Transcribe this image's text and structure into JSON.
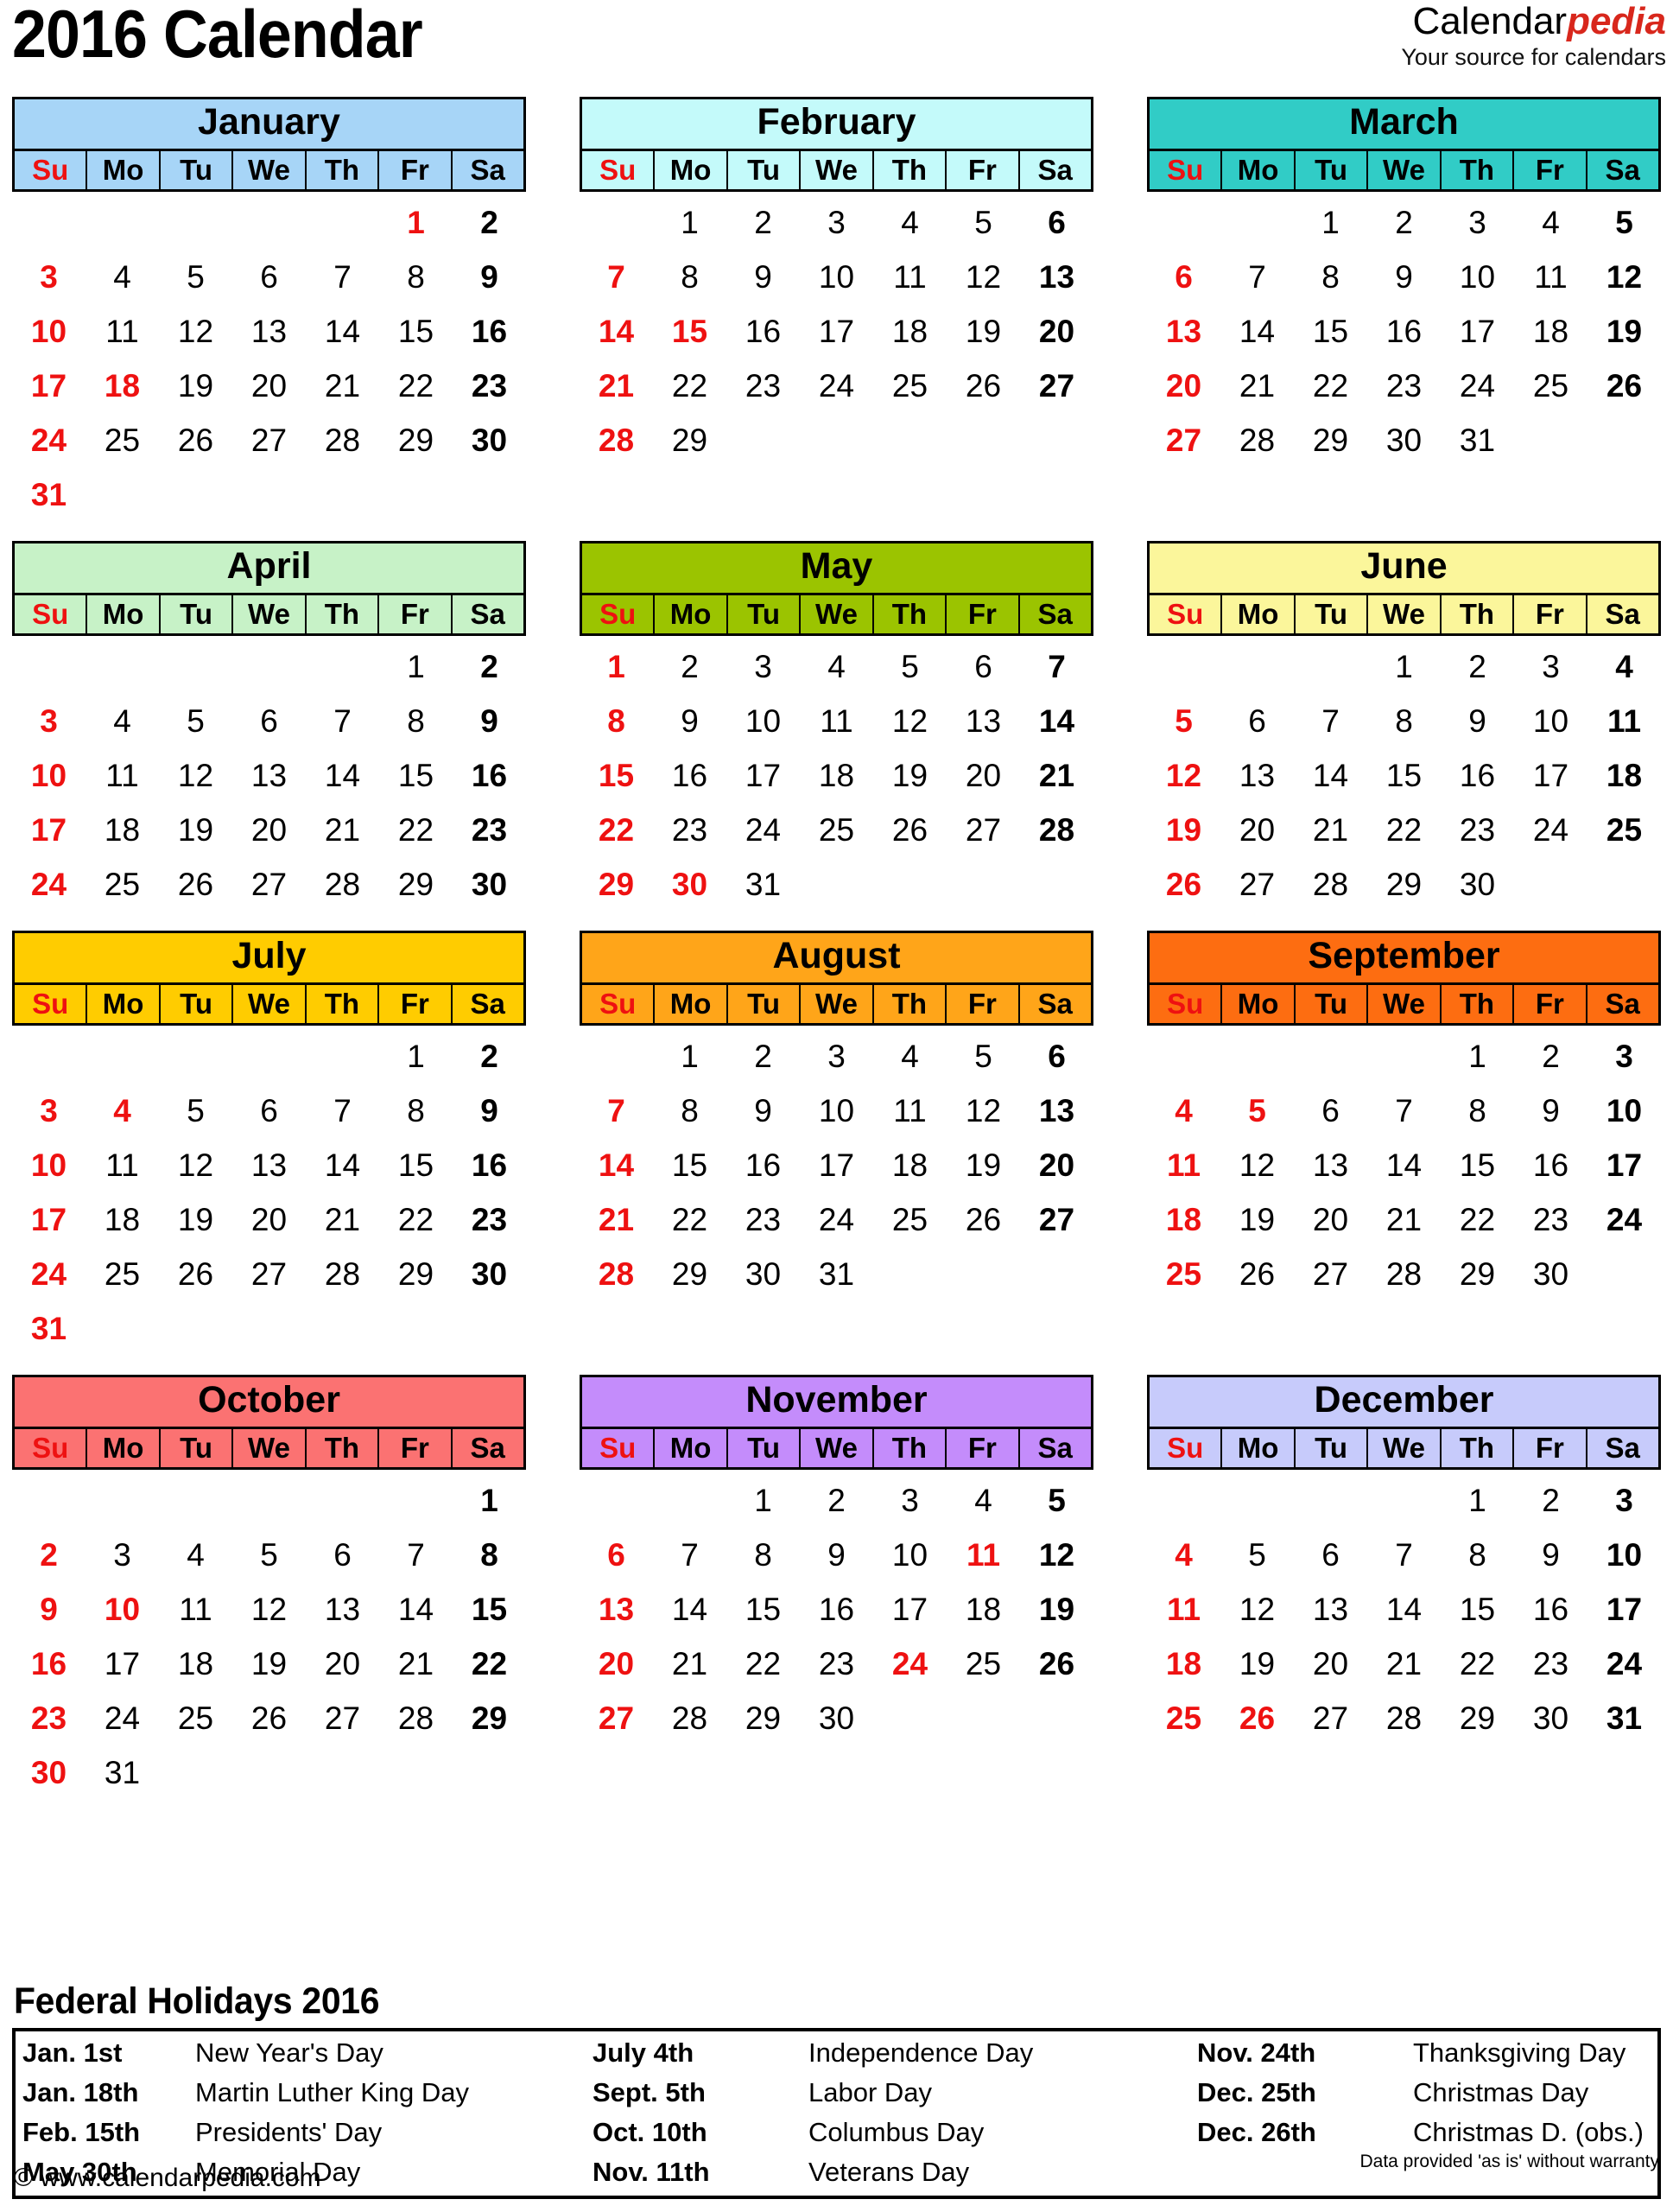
{
  "header": {
    "title": "2016 Calendar",
    "brand_primary": "Calendar",
    "brand_accent": "pedia",
    "tagline": "Your source for calendars"
  },
  "colors": {
    "sunday_red": "#ee1111",
    "brand_red": "#d8271c",
    "january": "#a7d5f7",
    "february": "#c4fafa",
    "march": "#31ccc6",
    "april": "#c7f2c7",
    "may": "#9bc400",
    "june": "#fbf69b",
    "july": "#ffcc00",
    "august": "#ffa519",
    "september": "#fd6d11",
    "october": "#fb7272",
    "november": "#c48cfb",
    "december": "#c7cbfb"
  },
  "weekdays": [
    "Su",
    "Mo",
    "Tu",
    "We",
    "Th",
    "Fr",
    "Sa"
  ],
  "months": [
    {
      "name": "January",
      "color": "#a7d5f7",
      "lead_blanks": 5,
      "days": 31,
      "holidays": [
        1,
        18
      ]
    },
    {
      "name": "February",
      "color": "#c4fafa",
      "lead_blanks": 1,
      "days": 29,
      "holidays": [
        15
      ]
    },
    {
      "name": "March",
      "color": "#31ccc6",
      "lead_blanks": 2,
      "days": 31,
      "holidays": []
    },
    {
      "name": "April",
      "color": "#c7f2c7",
      "lead_blanks": 5,
      "days": 30,
      "holidays": []
    },
    {
      "name": "May",
      "color": "#9bc400",
      "lead_blanks": 0,
      "days": 31,
      "holidays": [
        30
      ]
    },
    {
      "name": "June",
      "color": "#fbf69b",
      "lead_blanks": 3,
      "days": 30,
      "holidays": []
    },
    {
      "name": "July",
      "color": "#ffcc00",
      "lead_blanks": 5,
      "days": 31,
      "holidays": [
        4
      ]
    },
    {
      "name": "August",
      "color": "#ffa519",
      "lead_blanks": 1,
      "days": 31,
      "holidays": []
    },
    {
      "name": "September",
      "color": "#fd6d11",
      "lead_blanks": 4,
      "days": 30,
      "holidays": [
        5
      ]
    },
    {
      "name": "October",
      "color": "#fb7272",
      "lead_blanks": 6,
      "days": 31,
      "holidays": [
        10
      ]
    },
    {
      "name": "November",
      "color": "#c48cfb",
      "lead_blanks": 2,
      "days": 30,
      "holidays": [
        11,
        24
      ]
    },
    {
      "name": "December",
      "color": "#c7cbfb",
      "lead_blanks": 4,
      "days": 31,
      "holidays": [
        25,
        26
      ]
    }
  ],
  "holidays_section": {
    "heading": "Federal Holidays 2016",
    "entries": [
      {
        "date": "Jan. 1st",
        "name": "New Year's Day"
      },
      {
        "date": "July 4th",
        "name": "Independence Day"
      },
      {
        "date": "Nov. 24th",
        "name": "Thanksgiving Day"
      },
      {
        "date": "Jan. 18th",
        "name": "Martin Luther King Day"
      },
      {
        "date": "Sept. 5th",
        "name": "Labor Day"
      },
      {
        "date": "Dec. 25th",
        "name": "Christmas Day"
      },
      {
        "date": "Feb. 15th",
        "name": "Presidents' Day"
      },
      {
        "date": "Oct. 10th",
        "name": "Columbus Day"
      },
      {
        "date": "Dec. 26th",
        "name": "Christmas D. (obs.)"
      },
      {
        "date": "May 30th",
        "name": "Memorial Day"
      },
      {
        "date": "Nov. 11th",
        "name": "Veterans Day"
      },
      {
        "date": "",
        "name": ""
      }
    ]
  },
  "footer": {
    "copyright": "© www.calendarpedia.com",
    "disclaimer": "Data provided 'as is' without warranty"
  }
}
